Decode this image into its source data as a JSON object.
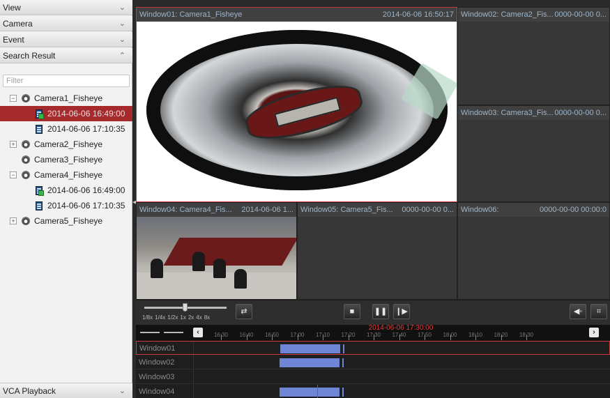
{
  "left_panel": {
    "sections": [
      {
        "label": "View",
        "chevron": "⌄"
      },
      {
        "label": "Camera",
        "chevron": "⌄"
      },
      {
        "label": "Event",
        "chevron": "⌄"
      },
      {
        "label": "Search Result",
        "chevron": "⌃"
      }
    ],
    "filter_placeholder": "Filter",
    "tree": [
      {
        "type": "camera",
        "label": "Camera1_Fisheye",
        "expander": "−"
      },
      {
        "type": "file",
        "label": "2014-06-06 16:49:00",
        "selected": true,
        "green": true
      },
      {
        "type": "file",
        "label": "2014-06-06 17:10:35"
      },
      {
        "type": "camera",
        "label": "Camera2_Fisheye",
        "expander": "+"
      },
      {
        "type": "camera",
        "label": "Camera3_Fisheye"
      },
      {
        "type": "camera",
        "label": "Camera4_Fisheye",
        "expander": "−"
      },
      {
        "type": "file",
        "label": "2014-06-06 16:49:00",
        "green": true
      },
      {
        "type": "file",
        "label": "2014-06-06 17:10:35"
      },
      {
        "type": "camera",
        "label": "Camera5_Fisheye",
        "expander": "+"
      }
    ],
    "bottom_section": {
      "label": "VCA Playback",
      "chevron": "⌄"
    }
  },
  "windows": {
    "w1": {
      "title": "Window01: Camera1_Fisheye",
      "time": "2014-06-06 16:50:17"
    },
    "w2": {
      "title": "Window02: Camera2_Fis...",
      "time": "0000-00-00 0..."
    },
    "w3": {
      "title": "Window03: Camera3_Fis...",
      "time": "0000-00-00 0..."
    },
    "w4": {
      "title": "Window04: Camera4_Fis...",
      "time": "2014-06-06 1..."
    },
    "w5": {
      "title": "Window05: Camera5_Fis...",
      "time": "0000-00-00 0..."
    },
    "w6": {
      "title": "Window06:",
      "time": "0000-00-00 00:00:0"
    }
  },
  "toolbar": {
    "speed_labels": [
      "1/8x",
      "1/4x",
      "1/2x",
      "1x",
      "2x",
      "4x",
      "8x"
    ],
    "speed_value": "1x",
    "buttons": {
      "sync_icon": "sync-icon",
      "stop_icon": "stop-icon",
      "pause_icon": "pause-icon",
      "frame_icon": "single-frame-icon",
      "mute_icon": "audio-off-icon",
      "fullscreen_icon": "fullscreen-icon"
    }
  },
  "timeline": {
    "current_time": "2014-06-06 17:30:00",
    "ticks": [
      "16:30",
      "16:40",
      "16:50",
      "17:00",
      "17:10",
      "17:20",
      "17:30",
      "17:40",
      "17:50",
      "18:00",
      "18:10",
      "18:20",
      "18:30"
    ],
    "rows": [
      {
        "label": "Window01",
        "active": true,
        "has_record": true
      },
      {
        "label": "Window02",
        "has_record": true
      },
      {
        "label": "Window03",
        "has_record": false
      },
      {
        "label": "Window04",
        "has_record": true
      }
    ],
    "colors": {
      "record": "#6f86d6",
      "cursor": "#d23a3a",
      "active_border": "#d23a3a"
    }
  }
}
